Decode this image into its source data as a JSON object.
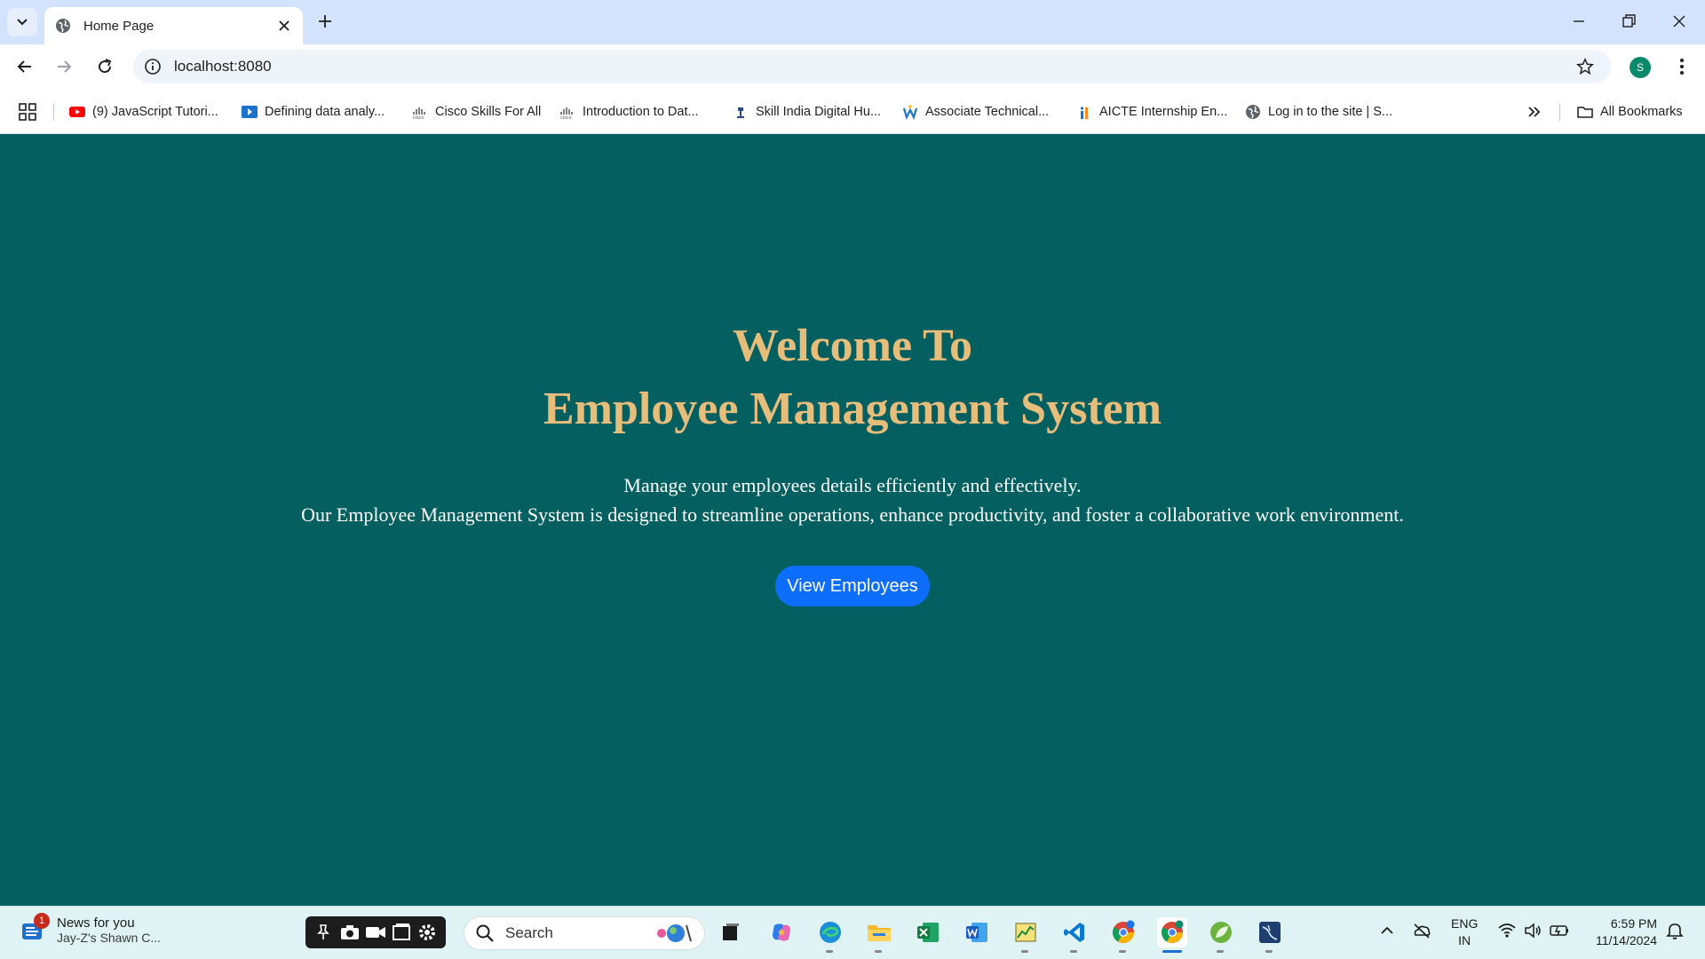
{
  "browser": {
    "tab_title": "Home Page",
    "url": "localhost:8080",
    "profile_initial": "S",
    "bookmarks": [
      {
        "label": "(9) JavaScript Tutori..."
      },
      {
        "label": "Defining data analy..."
      },
      {
        "label": "Cisco Skills For All"
      },
      {
        "label": "Introduction to Dat..."
      },
      {
        "label": "Skill India Digital Hu..."
      },
      {
        "label": "Associate Technical..."
      },
      {
        "label": "AICTE Internship En..."
      },
      {
        "label": "Log in to the site | S..."
      }
    ],
    "all_bookmarks_label": "All Bookmarks"
  },
  "page": {
    "heading_line1": "Welcome To",
    "heading_line2": "Employee Management System",
    "paragraph_line1": "Manage your employees details efficiently and effectively.",
    "paragraph_line2": "Our Employee Management System is designed to streamline operations, enhance productivity, and foster a collaborative work environment.",
    "button_label": "View Employees",
    "colors": {
      "background": "#046060",
      "heading": "#e6bd7b",
      "button": "#0d6efd"
    }
  },
  "taskbar": {
    "news_badge": "1",
    "news_title": "News for you",
    "news_subtitle": "Jay-Z's Shawn C...",
    "search_placeholder": "Search",
    "language_line1": "ENG",
    "language_line2": "IN",
    "time": "6:59 PM",
    "date": "11/14/2024"
  }
}
